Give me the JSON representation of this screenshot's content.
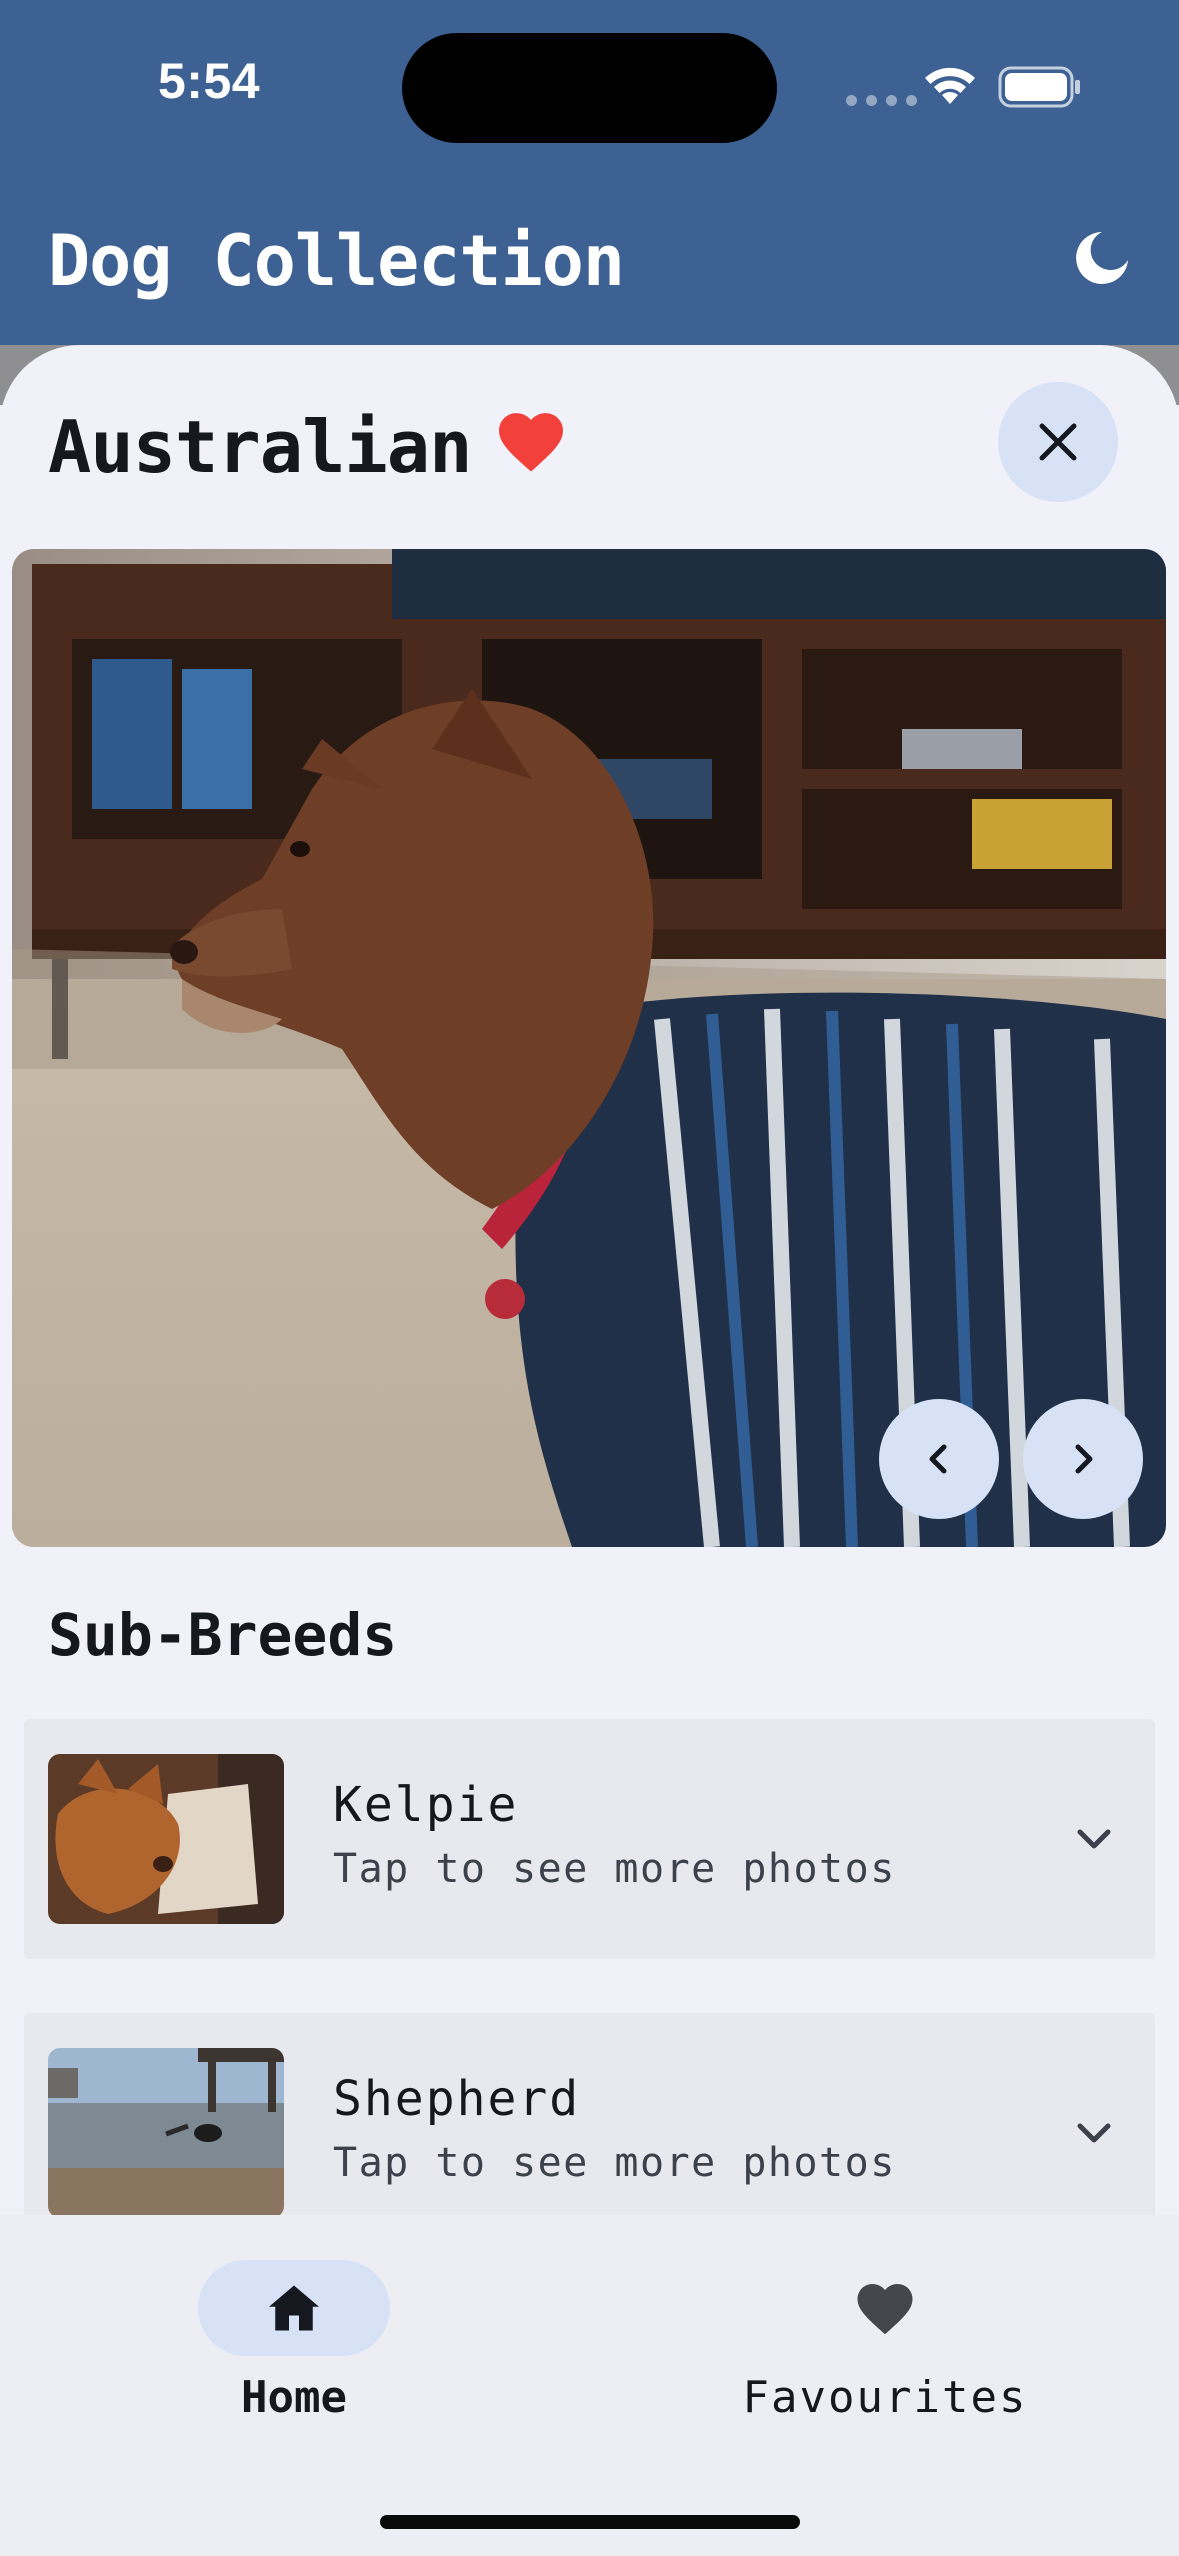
{
  "status_bar": {
    "time": "5:54"
  },
  "app_bar": {
    "title": "Dog Collection",
    "theme_icon": "moon-icon"
  },
  "detail": {
    "breed_name": "Australian",
    "favourited": true,
    "favourite_icon": "heart-icon",
    "close_icon": "close-icon",
    "prev_icon": "chevron-left-icon",
    "next_icon": "chevron-right-icon"
  },
  "sub_breeds": {
    "title": "Sub-Breeds",
    "items": [
      {
        "name": "Kelpie",
        "subtitle": "Tap to see more photos"
      },
      {
        "name": "Shepherd",
        "subtitle": "Tap to see more photos"
      }
    ]
  },
  "bottom_nav": {
    "items": [
      {
        "label": "Home",
        "icon": "home-icon",
        "active": true
      },
      {
        "label": "Favourites",
        "icon": "heart-icon",
        "active": false
      }
    ]
  },
  "colors": {
    "primary": "#3c6192",
    "accent_container": "#d8e2f6",
    "favourite": "#f1413a",
    "background": "#f0f1f9"
  }
}
